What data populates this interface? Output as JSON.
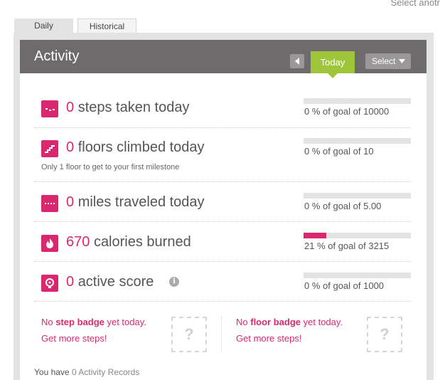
{
  "top_link": "Select anotr",
  "tabs": {
    "daily": "Daily",
    "historical": "Historical"
  },
  "header": {
    "title": "Activity",
    "today_label": "Today",
    "select_label": "Select"
  },
  "metrics": [
    {
      "icon": "steps-icon",
      "value": "0",
      "label": "steps taken today",
      "goal_text": "0 % of goal of 10000",
      "progress": 0
    },
    {
      "icon": "floors-icon",
      "value": "0",
      "label": "floors climbed today",
      "hint": "Only 1 floor to get to your first milestone",
      "goal_text": "0 % of goal of 10",
      "progress": 0
    },
    {
      "icon": "miles-icon",
      "value": "0",
      "label": "miles traveled today",
      "goal_text": "0 % of goal of 5.00",
      "progress": 0
    },
    {
      "icon": "calories-flame-icon",
      "value": "670",
      "label": "calories burned",
      "goal_text": "21 % of goal of 3215",
      "progress": 0.21
    },
    {
      "icon": "active-score-icon",
      "value": "0",
      "label": "active score",
      "goal_text": "0 % of goal of 1000",
      "progress": 0,
      "info": "i"
    }
  ],
  "badges": {
    "step": {
      "prefix": "No ",
      "name": "step badge",
      "suffix": " yet today.",
      "link": "Get more steps!",
      "placeholder": "?"
    },
    "floor": {
      "prefix": "No ",
      "name": "floor badge",
      "suffix": " yet today.",
      "link": "Get more steps!",
      "placeholder": "?"
    }
  },
  "records": {
    "prefix": "You have ",
    "count": "0 Activity Records"
  },
  "colors": {
    "accent": "#d9286f",
    "today_tab": "#9fc63b",
    "header_bg": "#6d6b6b"
  }
}
